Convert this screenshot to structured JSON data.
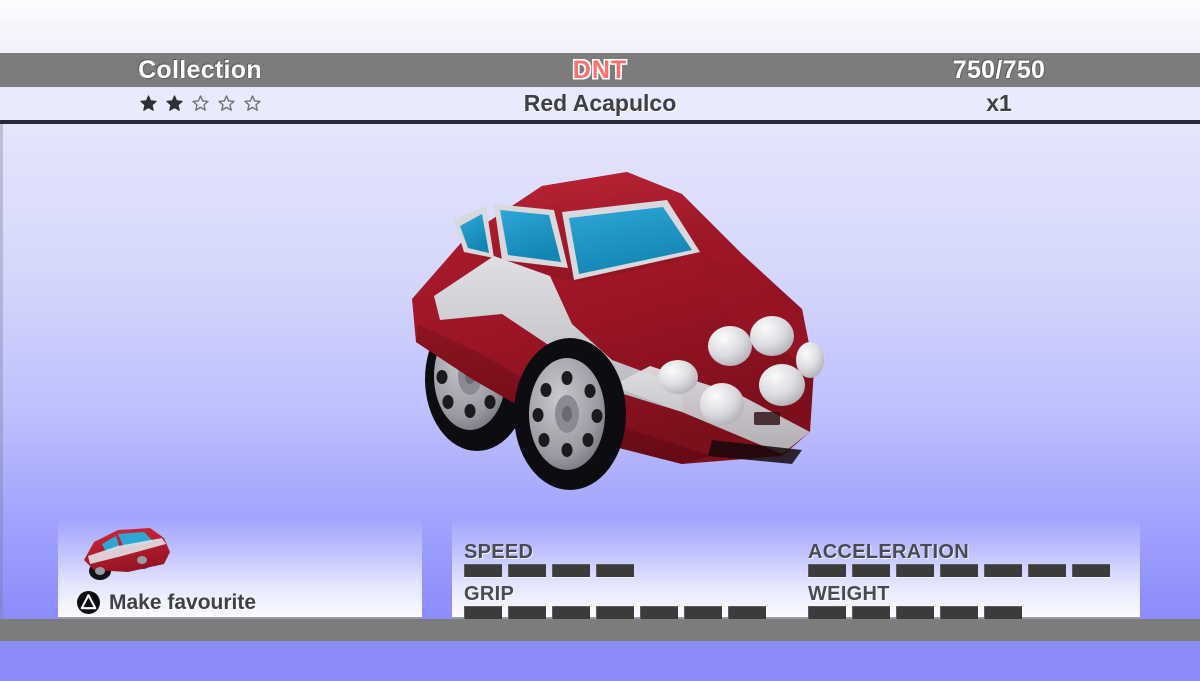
{
  "header": {
    "left_title": "Collection",
    "center_title": "DNT",
    "right_title": "750/750"
  },
  "subheader": {
    "rating_filled": 2,
    "rating_total": 5,
    "car_name": "Red Acapulco",
    "quantity": "x1"
  },
  "vehicle": {
    "body_color": "#a81728",
    "body_color_dark": "#7d0f1d",
    "body_color_light": "#c2273b",
    "window_color": "#2196c4",
    "stripe_color": "#c9c9cf",
    "wheel_color": "#101014",
    "rim_color": "#9a9aa2",
    "light_color": "#e3e3e6"
  },
  "favourite_panel": {
    "action_label": "Make favourite",
    "button_icon": "triangle-button-icon",
    "thumbnail_icon": "car-thumbnail-icon"
  },
  "stats": [
    {
      "key": "speed",
      "label": "SPEED",
      "value": 4,
      "max": 10
    },
    {
      "key": "acceleration",
      "label": "ACCELERATION",
      "value": 7,
      "max": 10
    },
    {
      "key": "grip",
      "label": "GRIP",
      "value": 7,
      "max": 10
    },
    {
      "key": "weight",
      "label": "WEIGHT",
      "value": 5,
      "max": 10
    }
  ],
  "colors": {
    "header_bar": "#7c7c7c",
    "subheader_bar": "#e9eafb",
    "divider": "#2a2a33",
    "dnt_red": "#ff6d6d",
    "background_top": "#e4e6fb",
    "background_bottom": "#8b8bfc",
    "stat_bar": "#3b3b3b",
    "panel_bottom": "#fbfbff"
  }
}
